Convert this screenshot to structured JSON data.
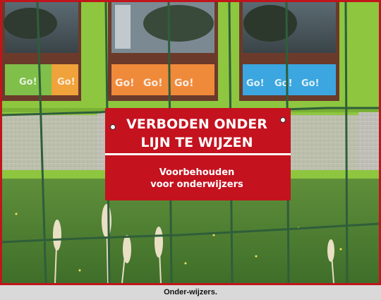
{
  "sign": {
    "headline_line1": "VERBODEN ONDER",
    "headline_line2": "LIJN TE WIJZEN",
    "subline_line1": "Voorbehouden",
    "subline_line2": "voor onderwijzers"
  },
  "window_posters": {
    "text": "Go!"
  },
  "caption": "Onder-wijzers.",
  "colors": {
    "frame": "#c0151b",
    "sign_red": "#c4121f",
    "window_trim": "#8ec63f",
    "fence": "#2f5e3a"
  }
}
